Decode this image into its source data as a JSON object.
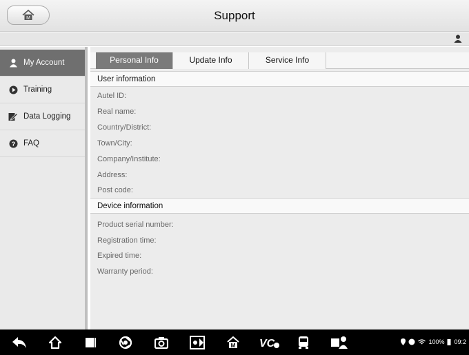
{
  "header": {
    "title": "Support"
  },
  "sidebar": {
    "items": [
      {
        "label": "My Account",
        "icon": "user-icon",
        "active": true
      },
      {
        "label": "Training",
        "icon": "play-icon",
        "active": false
      },
      {
        "label": "Data Logging",
        "icon": "edit-icon",
        "active": false
      },
      {
        "label": "FAQ",
        "icon": "help-icon",
        "active": false
      }
    ]
  },
  "tabs": [
    {
      "label": "Personal Info",
      "active": true
    },
    {
      "label": "Update Info",
      "active": false
    },
    {
      "label": "Service Info",
      "active": false
    }
  ],
  "user_section": {
    "title": "User information",
    "fields": [
      "Autel ID:",
      "Real name:",
      "Country/District:",
      "Town/City:",
      "Company/Institute:",
      "Address:",
      "Post code:"
    ]
  },
  "device_section": {
    "title": "Device information",
    "fields": [
      "Product serial number:",
      "Registration time:",
      "Expired time:",
      "Warranty period:"
    ]
  },
  "status_bar": {
    "battery": "100%",
    "time": "09:2"
  },
  "colors": {
    "active_sidebar": "#6f6f6f",
    "active_tab": "#7a7a7a",
    "navbar": "#000000"
  }
}
